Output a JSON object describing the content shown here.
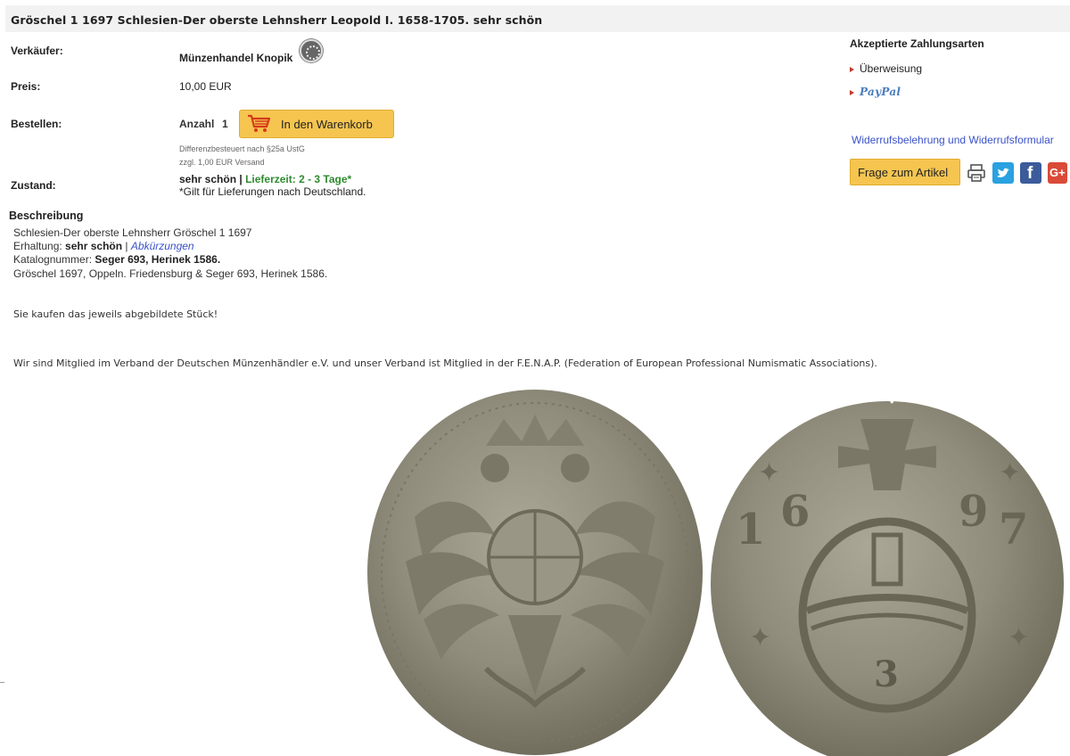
{
  "title": "Gröschel 1 1697 Schlesien-Der oberste Lehnsherr Leopold I. 1658-1705. sehr schön",
  "details": {
    "seller_label": "Verkäufer:",
    "seller_name": "Münzenhandel Knopik",
    "price_label": "Preis:",
    "price_value": "10,00 EUR",
    "order_label": "Bestellen:",
    "qty_label": "Anzahl",
    "qty_value": "1",
    "cart_button": "In den Warenkorb",
    "tax_note": "Differenzbesteuert nach §25a UstG",
    "shipping_note": "zzgl. 1,00 EUR Versand",
    "condition_label": "Zustand:",
    "condition_value": "sehr schön",
    "separator": "|",
    "delivery": "Lieferzeit: 2 - 3 Tage*",
    "delivery_note": "*Gilt für Lieferungen nach Deutschland."
  },
  "payment": {
    "title": "Akzeptierte Zahlungsarten",
    "methods": [
      "Überweisung",
      "PayPal"
    ],
    "withdrawal_link": "Widerrufsbelehrung und Widerrufsformular",
    "question_button": "Frage zum Artikel"
  },
  "description": {
    "heading": "Beschreibung",
    "line1": "Schlesien-Der oberste Lehnsherr Gröschel 1 1697",
    "erhaltung_label": "Erhaltung:",
    "erhaltung_value": "sehr schön",
    "erhaltung_sep": "|",
    "abbreviations_link": "Abkürzungen",
    "katalog_label": "Katalognummer:",
    "katalog_value": "Seger 693, Herinek 1586.",
    "line4": "Gröschel 1697, Oppeln. Friedensburg & Seger 693, Herinek 1586."
  },
  "notes": {
    "piece_note": "Sie kaufen das jeweils abgebildete Stück!",
    "membership": "Wir sind Mitglied im Verband der Deutschen Münzenhändler e.V. und unser Verband ist Mitglied in der F.E.N.A.P. (Federation of European Professional Numismatic Associations)."
  },
  "colors": {
    "button_yellow": "#f5c550",
    "link_blue": "#3a52c8",
    "delivery_green": "#2e8b2e",
    "coin_silver": "#9a9684"
  },
  "coin": {
    "reverse_digits_left": [
      "1",
      "6"
    ],
    "reverse_digits_right": [
      "9",
      "7"
    ],
    "reverse_value": "3"
  }
}
